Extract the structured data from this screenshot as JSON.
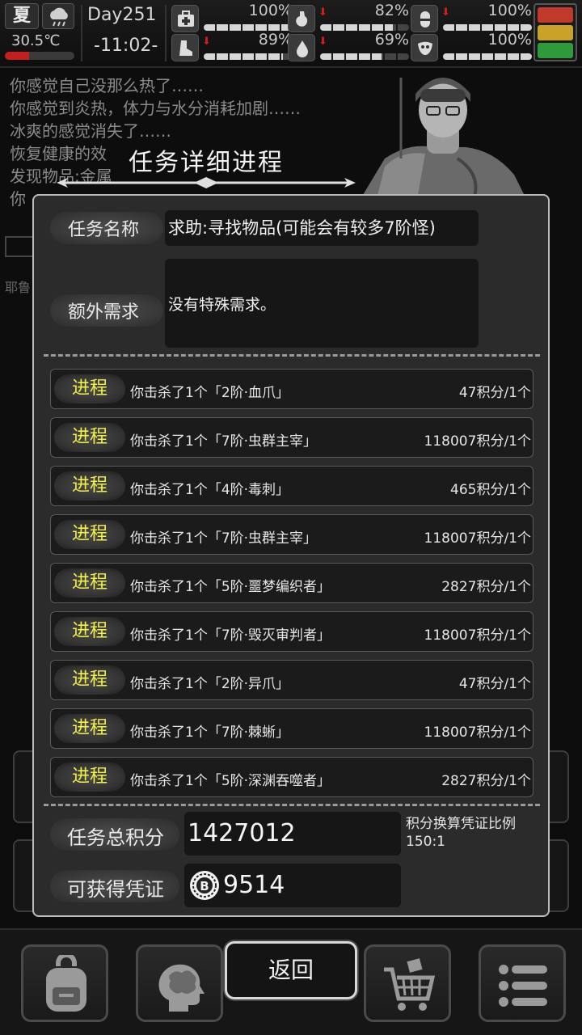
{
  "status": {
    "season": "夏",
    "temperature": "30.5℃",
    "temperature_level": 0.35,
    "day": "Day251",
    "time": "-11:02-",
    "stats": [
      {
        "name": "health",
        "icon": "first-aid-icon",
        "value": "100%",
        "level": 1.0,
        "declining": false
      },
      {
        "name": "hunger",
        "icon": "stomach-icon",
        "value": "82%",
        "level": 0.82,
        "declining": true
      },
      {
        "name": "medicine",
        "icon": "pill-icon",
        "value": "100%",
        "level": 1.0,
        "declining": true
      },
      {
        "name": "stamina",
        "icon": "boot-icon",
        "value": "89%",
        "level": 0.89,
        "declining": true
      },
      {
        "name": "water",
        "icon": "water-drop-icon",
        "value": "69%",
        "level": 0.69,
        "declining": true
      },
      {
        "name": "mood",
        "icon": "mask-icon",
        "value": "100%",
        "level": 1.0,
        "declining": false
      }
    ],
    "mood_colors": [
      "#c0392b",
      "#c9a227",
      "#2e9a3c"
    ]
  },
  "log": [
    "你感觉自己没那么热了……",
    "你感觉到炎热，体力与水分消耗加剧……",
    "冰爽的感觉消失了……",
    "恢复健康的效",
    "发现物品:金属",
    "你"
  ],
  "background_text": "耶鲁",
  "modal": {
    "title": "任务详细进程",
    "task_name_label": "任务名称",
    "task_name": "求助:寻找物品(可能会有较多7阶怪)",
    "extra_label": "额外需求",
    "extra_value": "没有特殊需求。",
    "progress_items": [
      {
        "tag": "进程",
        "desc": "你击杀了1个「2阶·血爪」",
        "points": "47积分/1个"
      },
      {
        "tag": "进程",
        "desc": "你击杀了1个「7阶·虫群主宰」",
        "points": "118007积分/1个"
      },
      {
        "tag": "进程",
        "desc": "你击杀了1个「4阶·毒刺」",
        "points": "465积分/1个"
      },
      {
        "tag": "进程",
        "desc": "你击杀了1个「7阶·虫群主宰」",
        "points": "118007积分/1个"
      },
      {
        "tag": "进程",
        "desc": "你击杀了1个「5阶·噩梦编织者」",
        "points": "2827积分/1个"
      },
      {
        "tag": "进程",
        "desc": "你击杀了1个「7阶·毁灭审判者」",
        "points": "118007积分/1个"
      },
      {
        "tag": "进程",
        "desc": "你击杀了1个「2阶·异爪」",
        "points": "47积分/1个"
      },
      {
        "tag": "进程",
        "desc": "你击杀了1个「7阶·棘蜥」",
        "points": "118007积分/1个"
      },
      {
        "tag": "进程",
        "desc": "你击杀了1个「5阶·深渊吞噬者」",
        "points": "2827积分/1个"
      }
    ],
    "total_label": "任务总积分",
    "total_value": "1427012",
    "ratio_label": "积分换算凭证比例",
    "ratio_value": "150:1",
    "voucher_label": "可获得凭证",
    "voucher_value": "9514"
  },
  "bottom_nav": {
    "back_label": "返回",
    "items": [
      {
        "name": "backpack",
        "icon": "backpack-icon"
      },
      {
        "name": "skills",
        "icon": "brain-icon"
      },
      {
        "name": "shop",
        "icon": "cart-icon"
      },
      {
        "name": "menu",
        "icon": "menu-icon"
      }
    ]
  }
}
